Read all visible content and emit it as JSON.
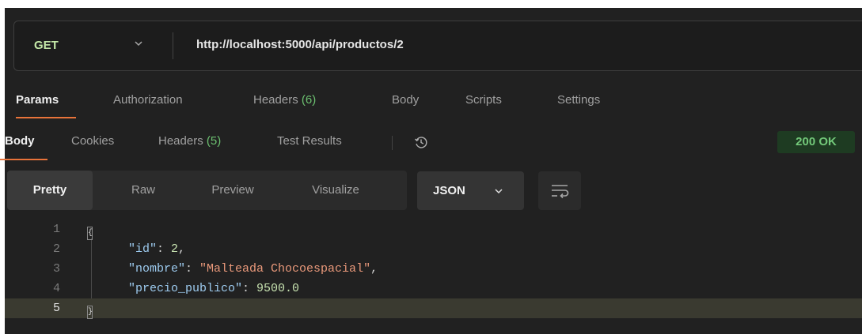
{
  "request": {
    "method": "GET",
    "url": "http://localhost:5000/api/productos/2"
  },
  "request_tabs": {
    "params": "Params",
    "authorization": "Authorization",
    "headers": "Headers",
    "headers_count": "(6)",
    "body": "Body",
    "scripts": "Scripts",
    "settings": "Settings"
  },
  "response_tabs": {
    "body": "Body",
    "cookies": "Cookies",
    "headers": "Headers",
    "headers_count": "(5)",
    "test_results": "Test Results",
    "status": "200 OK"
  },
  "view_modes": {
    "pretty": "Pretty",
    "raw": "Raw",
    "preview": "Preview",
    "visualize": "Visualize",
    "format": "JSON"
  },
  "icons": {
    "method_dropdown": "chevron-down-icon",
    "history": "history-icon",
    "format_dropdown": "chevron-down-icon",
    "wrap": "wrap-lines-icon"
  },
  "editor": {
    "line_numbers": [
      "1",
      "2",
      "3",
      "4",
      "5"
    ],
    "lines": [
      {
        "key": "",
        "value": "",
        "open": "{"
      },
      {
        "key": "\"id\"",
        "sep": ": ",
        "value": "2",
        "end": ","
      },
      {
        "key": "\"nombre\"",
        "sep": ": ",
        "value": "\"Malteada Chocoespacial\"",
        "end": ","
      },
      {
        "key": "\"precio_publico\"",
        "sep": ": ",
        "value": "9500.0",
        "end": ""
      },
      {
        "key": "",
        "value": "",
        "close": "}"
      }
    ]
  },
  "colors": {
    "method": "#c4e8a8",
    "accent_underline": "#e8733a",
    "status_ok": "#73c97a",
    "json_key": "#9dcbef",
    "json_string": "#e8987a",
    "json_number": "#c7e2b0"
  }
}
